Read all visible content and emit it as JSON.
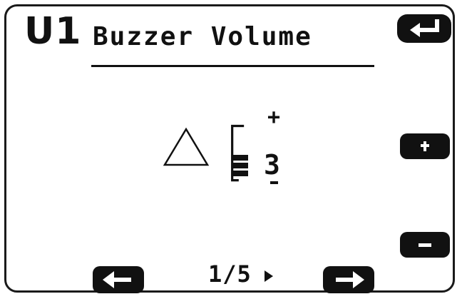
{
  "screen": {
    "menu_code": "U1",
    "menu_title": "Buzzer Volume"
  },
  "volume": {
    "value": "3",
    "plus": "+",
    "level": 3,
    "max_level": 3
  },
  "pagination": {
    "indicator": "1/5"
  },
  "icons": {
    "enter": "enter-return-icon",
    "increase": "plus-icon",
    "decrease": "minus-icon",
    "previous": "left-arrow-icon",
    "next": "right-arrow-icon",
    "warning": "triangle-icon",
    "page_next": "play-right-icon"
  },
  "colors": {
    "foreground": "#111111",
    "background": "#ffffff"
  }
}
